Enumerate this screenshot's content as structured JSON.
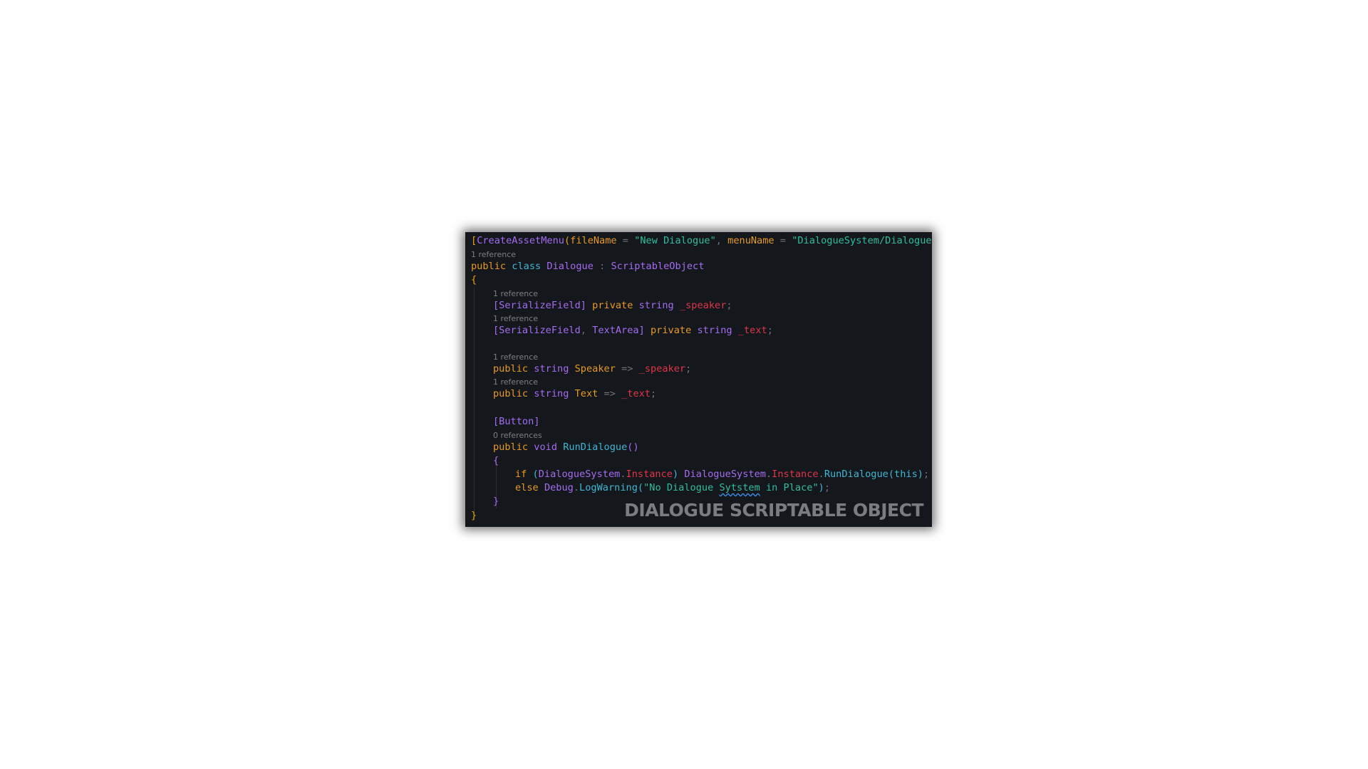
{
  "code": {
    "attribute_line": {
      "open_bracket": "[",
      "attr_name": "CreateAssetMenu",
      "open_paren": "(",
      "param1_name": "fileName",
      "eq1": " = ",
      "param1_value": "\"New Dialogue\"",
      "comma": ", ",
      "param2_name": "menuName",
      "eq2": " = ",
      "param2_value": "\"DialogueSystem/Dialogue\"",
      "close_paren": ")",
      "close_bracket": "]"
    },
    "class_lens": "1 reference",
    "class_decl": {
      "kw_public": "public",
      "kw_class": "class",
      "class_name": "Dialogue",
      "colon": " : ",
      "base_class": "ScriptableObject"
    },
    "open_brace": "{",
    "field_speaker": {
      "lens": "1 reference",
      "attr": "[SerializeField]",
      "kw_private": "private",
      "kw_string": "string",
      "name": "_speaker",
      "semi": ";"
    },
    "field_text": {
      "lens": "1 reference",
      "attr_open": "[SerializeField",
      "attr_comma": ", ",
      "attr_second": "TextArea]",
      "kw_private": "private",
      "kw_string": "string",
      "name": "_text",
      "semi": ";"
    },
    "prop_speaker": {
      "lens": "1 reference",
      "kw_public": "public",
      "kw_string": "string",
      "name": "Speaker",
      "arrow": " => ",
      "target": "_speaker",
      "semi": ";"
    },
    "prop_text": {
      "lens": "1 reference",
      "kw_public": "public",
      "kw_string": "string",
      "name": "Text",
      "arrow": " => ",
      "target": "_text",
      "semi": ";"
    },
    "button_attr": "[Button]",
    "method": {
      "lens": "0 references",
      "kw_public": "public",
      "kw_void": "void",
      "name": "RunDialogue",
      "parens": "()",
      "open_brace": "{",
      "if_line": {
        "kw_if": "if",
        "open_paren": " (",
        "cls": "DialogueSystem",
        "dot": ".",
        "prop": "Instance",
        "close_paren": ")",
        "cls2": "DialogueSystem",
        "dot2": ".",
        "prop2": "Instance",
        "dot3": ".",
        "call": "RunDialogue",
        "call_open": "(",
        "kw_this": "this",
        "call_close": ")",
        "semi": ";"
      },
      "else_line": {
        "kw_else": "else",
        "cls": "Debug",
        "dot": ".",
        "call": "LogWarning",
        "call_open": "(",
        "str_start": "\"No Dialogue ",
        "str_typo": "Sytstem",
        "str_end": " in Place\"",
        "call_close": ")",
        "semi": ";"
      },
      "close_brace": "}"
    },
    "close_brace": "}"
  },
  "watermark": "DIALOGUE SCRIPTABLE OBJECT"
}
